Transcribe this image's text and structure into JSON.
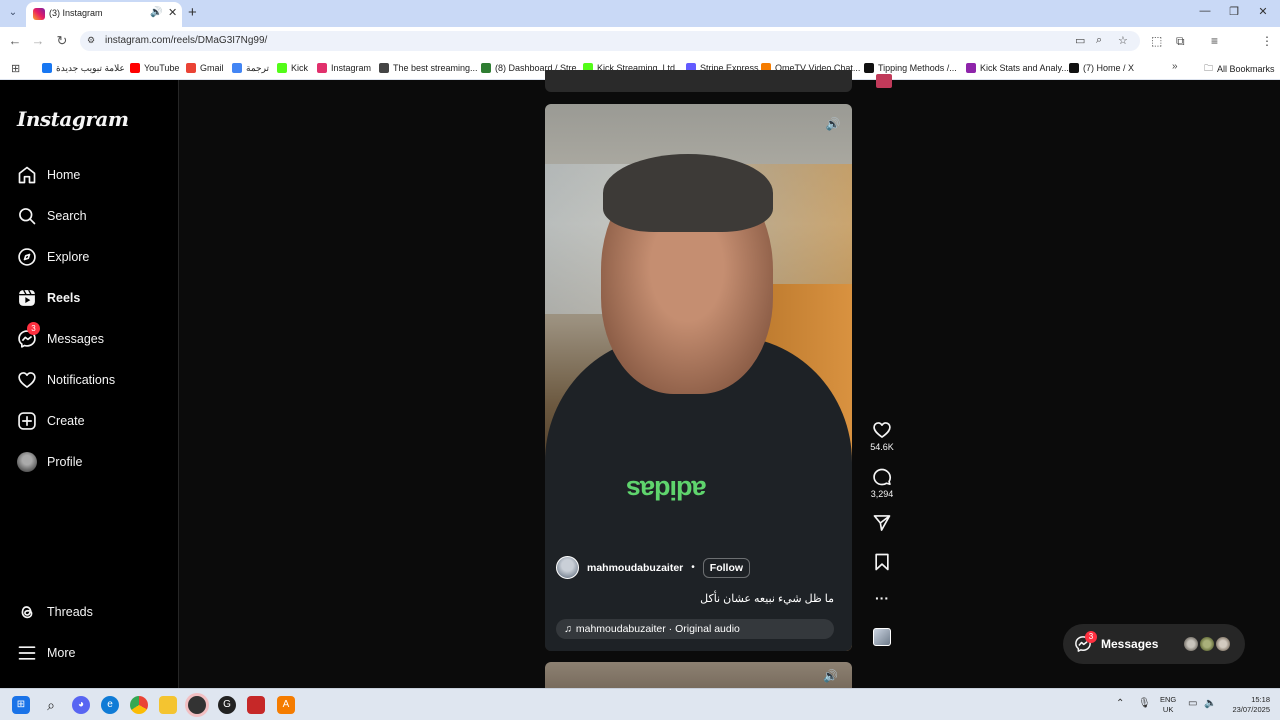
{
  "browser": {
    "tab_title": "(3) Instagram",
    "url": "instagram.com/reels/DMaG3I7Ng99/",
    "bookmarks": [
      {
        "label": "علامة تبويب جديدة",
        "color": "#1877f2"
      },
      {
        "label": "YouTube",
        "color": "#ff0000"
      },
      {
        "label": "Gmail",
        "color": "#ea4335"
      },
      {
        "label": "ترجمة",
        "color": "#4285f4"
      },
      {
        "label": "Kick",
        "color": "#53fc18"
      },
      {
        "label": "Instagram",
        "color": "#e1306c"
      },
      {
        "label": "The best streaming...",
        "color": "#444444"
      },
      {
        "label": "(8) Dashboard / Stre...",
        "color": "#2e7d32"
      },
      {
        "label": "Kick Streaming, Ltd....",
        "color": "#53fc18"
      },
      {
        "label": "Stripe Express",
        "color": "#635bff"
      },
      {
        "label": "OmeTV Video Chat...",
        "color": "#f57c00"
      },
      {
        "label": "Tipping Methods /...",
        "color": "#111111"
      },
      {
        "label": "Kick Stats and Analy...",
        "color": "#8e24aa"
      },
      {
        "label": "(7) Home / X",
        "color": "#111111"
      }
    ],
    "all_bookmarks": "All Bookmarks"
  },
  "sidebar": {
    "logo": "Instagram",
    "items": [
      {
        "label": "Home",
        "icon": "home-icon"
      },
      {
        "label": "Search",
        "icon": "search-icon"
      },
      {
        "label": "Explore",
        "icon": "compass-icon"
      },
      {
        "label": "Reels",
        "icon": "reels-icon",
        "active": true
      },
      {
        "label": "Messages",
        "icon": "messenger-icon",
        "badge": "3"
      },
      {
        "label": "Notifications",
        "icon": "heart-icon"
      },
      {
        "label": "Create",
        "icon": "plus-square-icon"
      },
      {
        "label": "Profile",
        "icon": "avatar"
      }
    ],
    "threads": "Threads",
    "more": "More"
  },
  "reel": {
    "username": "mahmoudabuzaiter",
    "separator": "•",
    "follow": "Follow",
    "caption": "ما ظل شيء نبيعه عشان نأكل",
    "audio": "mahmoudabuzaiter · Original audio",
    "shirt_brand": "adidas",
    "likes": "54.6K",
    "comments": "3,294"
  },
  "messages_pill": {
    "label": "Messages",
    "badge": "3"
  },
  "taskbar": {
    "lang_top": "ENG",
    "lang_bottom": "UK",
    "time": "15:18",
    "date": "23/07/2025"
  }
}
